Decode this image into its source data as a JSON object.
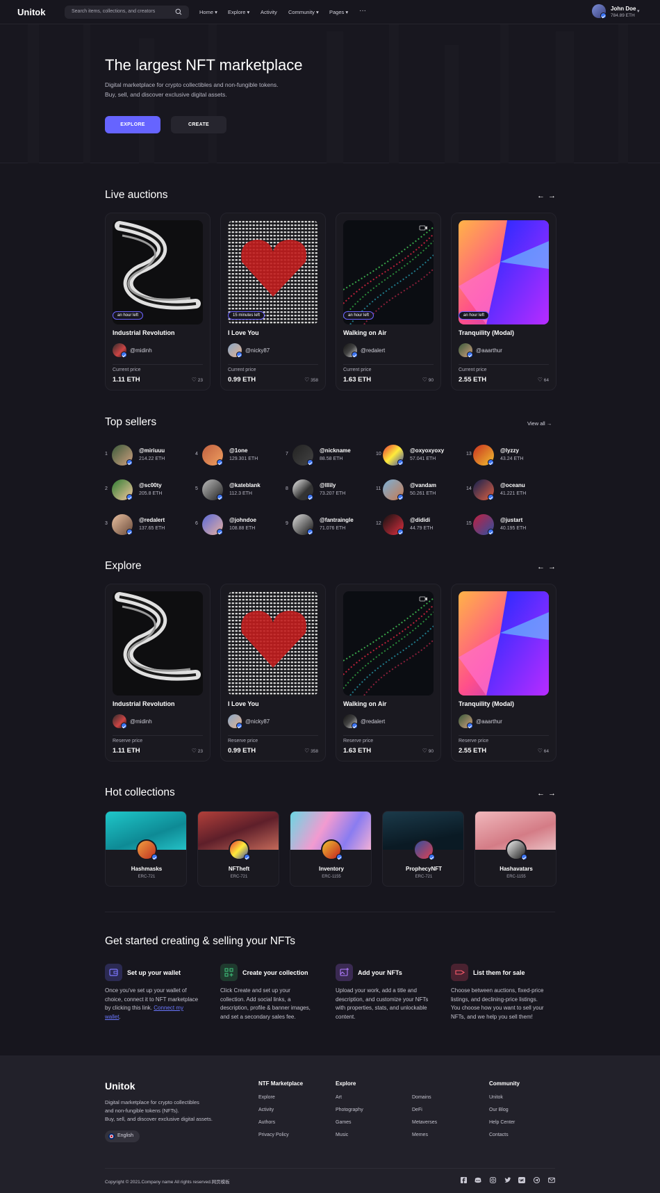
{
  "header": {
    "logo": "Unitok",
    "search_placeholder": "Search items, collections, and creators",
    "nav": [
      "Home",
      "Explore",
      "Activity",
      "Community",
      "Pages"
    ],
    "more": "···",
    "user_name": "John Doe",
    "user_balance": "784.89 ETH"
  },
  "hero": {
    "title": "The largest NFT marketplace",
    "line1": "Digital marketplace for crypto collectibles and non-fungible tokens.",
    "line2": "Buy, sell, and discover exclusive digital assets.",
    "explore_btn": "EXPLORE",
    "create_btn": "CREATE"
  },
  "live_auctions": {
    "title": "Live auctions",
    "price_label": "Current price",
    "cards": [
      {
        "time": "an hour left",
        "title": "Industrial Revolution",
        "owner": "@midinh",
        "price": "1.11 ETH",
        "likes": "23"
      },
      {
        "time": "15 minutes left",
        "title": "I Love You",
        "owner": "@nicky87",
        "price": "0.99 ETH",
        "likes": "358"
      },
      {
        "time": "an hour left",
        "title": "Walking on Air",
        "owner": "@redalert",
        "price": "1.63 ETH",
        "likes": "90"
      },
      {
        "time": "an hour left",
        "title": "Tranquility (Modal)",
        "owner": "@aaarthur",
        "price": "2.55 ETH",
        "likes": "64"
      }
    ]
  },
  "top_sellers": {
    "title": "Top sellers",
    "view_all": "View all",
    "sellers": [
      {
        "rank": "1",
        "name": "@miriuuu",
        "eth": "214.22 ETH"
      },
      {
        "rank": "2",
        "name": "@sc00ty",
        "eth": "205.8 ETH"
      },
      {
        "rank": "3",
        "name": "@redalert",
        "eth": "137.65 ETH"
      },
      {
        "rank": "4",
        "name": "@1one",
        "eth": "129.301 ETH"
      },
      {
        "rank": "5",
        "name": "@kateblank",
        "eth": "112.3 ETH"
      },
      {
        "rank": "6",
        "name": "@johndoe",
        "eth": "108.88 ETH"
      },
      {
        "rank": "7",
        "name": "@nickname",
        "eth": "88.58 ETH"
      },
      {
        "rank": "8",
        "name": "@lllily",
        "eth": "73.207 ETH"
      },
      {
        "rank": "9",
        "name": "@fantraingle",
        "eth": "71.076 ETH"
      },
      {
        "rank": "10",
        "name": "@oxyoxyoxy",
        "eth": "57.041 ETH"
      },
      {
        "rank": "11",
        "name": "@vandam",
        "eth": "50.261 ETH"
      },
      {
        "rank": "12",
        "name": "@dididi",
        "eth": "44.79 ETH"
      },
      {
        "rank": "13",
        "name": "@lyzzy",
        "eth": "43.24 ETH"
      },
      {
        "rank": "14",
        "name": "@oceanu",
        "eth": "41.221 ETH"
      },
      {
        "rank": "15",
        "name": "@justart",
        "eth": "40.195 ETH"
      }
    ]
  },
  "explore": {
    "title": "Explore",
    "price_label": "Reserve price",
    "cards": [
      {
        "title": "Industrial Revolution",
        "owner": "@midinh",
        "price": "1.11 ETH",
        "likes": "23"
      },
      {
        "title": "I Love You",
        "owner": "@nicky87",
        "price": "0.99 ETH",
        "likes": "358"
      },
      {
        "title": "Walking on Air",
        "owner": "@redalert",
        "price": "1.63 ETH",
        "likes": "90"
      },
      {
        "title": "Tranquility (Modal)",
        "owner": "@aaarthur",
        "price": "2.55 ETH",
        "likes": "64"
      }
    ]
  },
  "hot_collections": {
    "title": "Hot collections",
    "items": [
      {
        "name": "Hashmasks",
        "type": "ERC-721"
      },
      {
        "name": "NFTheft",
        "type": "ERC-721"
      },
      {
        "name": "Inventory",
        "type": "ERC-1155"
      },
      {
        "name": "ProphecyNFT",
        "type": "ERC-721"
      },
      {
        "name": "Hashavatars",
        "type": "ERC-1155"
      }
    ]
  },
  "get_started": {
    "title": "Get started creating & selling your NFTs",
    "steps": [
      {
        "title": "Set up your wallet",
        "desc": "Once you've set up your wallet of choice, connect it to NFT marketplace by clicking this link.",
        "link": "Connect my wallet",
        "after": "."
      },
      {
        "title": "Create your collection",
        "desc": "Click Create and set up your collection. Add social links, a description, profile & banner images, and set a secondary sales fee."
      },
      {
        "title": "Add your NFTs",
        "desc": "Upload your work, add a title and description, and customize your NFTs with properties, stats, and unlockable content."
      },
      {
        "title": "List them for sale",
        "desc": "Choose between auctions, fixed-price listings, and declining-price listings. You choose how you want to sell your NFTs, and we help you sell them!"
      }
    ]
  },
  "footer": {
    "logo": "Unitok",
    "desc1": "Digital marketplace for crypto collectibles",
    "desc2": "and non-fungible tokens (NFTs).",
    "desc3": "Buy, sell, and discover exclusive digital assets.",
    "language": "English",
    "col1_title": "NTF Marketplace",
    "col1": [
      "Explore",
      "Activity",
      "Authors",
      "Privacy Policy"
    ],
    "col2_title": "Explore",
    "col2": [
      "Art",
      "Photography",
      "Games",
      "Music"
    ],
    "col3": [
      "Domains",
      "DeFi",
      "Metaverses",
      "Memes"
    ],
    "col4_title": "Community",
    "col4": [
      "Unitok",
      "Our Blog",
      "Help Center",
      "Contacts"
    ],
    "copyright": "Copyright © 2021.Company name All rights reserved.网页模板"
  },
  "colors": {
    "accent": "#6664ff",
    "verified": "#3c74f2",
    "bg": "#17161e",
    "footer_bg": "#22212a"
  }
}
